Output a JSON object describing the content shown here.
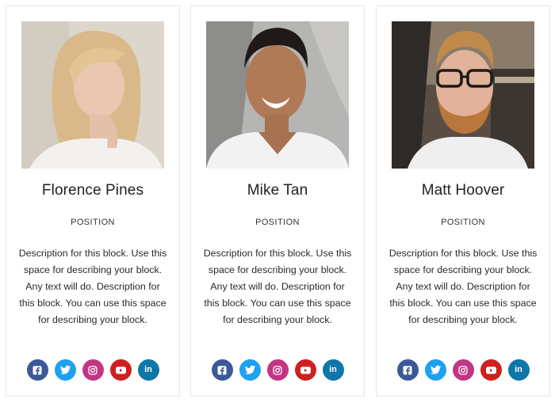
{
  "cards": [
    {
      "name": "Florence Pines",
      "position": "POSITION",
      "description": "Description for this block. Use this space for describing your block. Any text will do. Description for this block. You can use this space for describing your block.",
      "photo": "woman-blonde-photo"
    },
    {
      "name": "Mike Tan",
      "position": "POSITION",
      "description": "Description for this block. Use this space for describing your block. Any text will do. Description for this block. You can use this space for describing your block.",
      "photo": "man-smiling-photo"
    },
    {
      "name": "Matt Hoover",
      "position": "POSITION",
      "description": "Description for this block. Use this space for describing your block. Any text will do. Description for this block. You can use this space for describing your block.",
      "photo": "man-glasses-beard-photo"
    }
  ],
  "social": {
    "icons": [
      "facebook-icon",
      "twitter-icon",
      "instagram-icon",
      "youtube-icon",
      "linkedin-icon"
    ],
    "linkedin_label": "in",
    "colors": {
      "facebook": "#3b5998",
      "twitter": "#1da1f2",
      "instagram": "#c13584",
      "youtube": "#cd201f",
      "linkedin": "#0e76a8"
    }
  }
}
